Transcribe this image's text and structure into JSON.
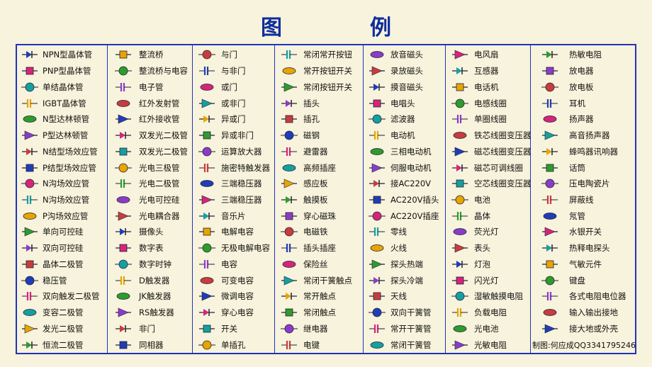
{
  "title": [
    "图",
    "例"
  ],
  "columns": [
    [
      {
        "label": "NPN型晶体管",
        "icon": "npn-transistor-icon"
      },
      {
        "label": "PNP型晶体管",
        "icon": "pnp-transistor-icon"
      },
      {
        "label": "单结晶体管",
        "icon": "unijunction-transistor-icon"
      },
      {
        "label": "IGBT晶体管",
        "icon": "igbt-icon"
      },
      {
        "label": "N型达林顿管",
        "icon": "n-darlington-icon"
      },
      {
        "label": "P型达林顿管",
        "icon": "p-darlington-icon"
      },
      {
        "label": "N结型场效应管",
        "icon": "n-jfet-icon"
      },
      {
        "label": "P结型场效应管",
        "icon": "p-jfet-icon"
      },
      {
        "label": "N沟场效应管",
        "icon": "n-channel-fet-icon"
      },
      {
        "label": "N沟场效应管",
        "icon": "n-channel-fet-icon"
      },
      {
        "label": "P沟场效应管",
        "icon": "p-channel-fet-icon"
      },
      {
        "label": "单向可控硅",
        "icon": "scr-icon"
      },
      {
        "label": "双向可控硅",
        "icon": "triac-icon"
      },
      {
        "label": "晶体二极管",
        "icon": "diode-icon"
      },
      {
        "label": "稳压管",
        "icon": "zener-diode-icon"
      },
      {
        "label": "双向触发二极管",
        "icon": "diac-icon"
      },
      {
        "label": "变容二极管",
        "icon": "varactor-icon"
      },
      {
        "label": "发光二极管",
        "icon": "led-icon"
      },
      {
        "label": "恒流二极管",
        "icon": "constant-current-diode-icon"
      }
    ],
    [
      {
        "label": "整流桥",
        "icon": "bridge-rectifier-icon"
      },
      {
        "label": "整流桥与电容",
        "icon": "rectifier-capacitor-icon"
      },
      {
        "label": "电子管",
        "icon": "vacuum-tube-icon"
      },
      {
        "label": "红外发射管",
        "icon": "ir-emitter-icon"
      },
      {
        "label": "红外接收管",
        "icon": "ir-receiver-icon"
      },
      {
        "label": "双发光二极管",
        "icon": "dual-led-icon"
      },
      {
        "label": "双发光二极管",
        "icon": "dual-led-icon"
      },
      {
        "label": "光电三极管",
        "icon": "phototransistor-icon"
      },
      {
        "label": "光电二极管",
        "icon": "photodiode-icon"
      },
      {
        "label": "光电可控硅",
        "icon": "photo-scr-icon"
      },
      {
        "label": "光电耦合器",
        "icon": "optocoupler-icon"
      },
      {
        "label": "摄像头",
        "icon": "camera-icon"
      },
      {
        "label": "数字表",
        "icon": "digital-meter-icon"
      },
      {
        "label": "数字时钟",
        "icon": "digital-clock-icon"
      },
      {
        "label": "D触发器",
        "icon": "d-flipflop-icon"
      },
      {
        "label": "JK触发器",
        "icon": "jk-flipflop-icon"
      },
      {
        "label": "RS触发器",
        "icon": "rs-flipflop-icon"
      },
      {
        "label": "非门",
        "icon": "not-gate-icon"
      },
      {
        "label": "同相器",
        "icon": "buffer-icon"
      }
    ],
    [
      {
        "label": "与门",
        "icon": "and-gate-icon"
      },
      {
        "label": "与非门",
        "icon": "nand-gate-icon"
      },
      {
        "label": "或门",
        "icon": "or-gate-icon"
      },
      {
        "label": "或非门",
        "icon": "nor-gate-icon"
      },
      {
        "label": "异或门",
        "icon": "xor-gate-icon"
      },
      {
        "label": "异或非门",
        "icon": "xnor-gate-icon"
      },
      {
        "label": "运算放大器",
        "icon": "op-amp-icon"
      },
      {
        "label": "施密特触发器",
        "icon": "schmitt-trigger-icon"
      },
      {
        "label": "三端稳压器",
        "icon": "voltage-regulator-icon"
      },
      {
        "label": "三端稳压器",
        "icon": "voltage-regulator-icon"
      },
      {
        "label": "音乐片",
        "icon": "music-chip-icon"
      },
      {
        "label": "电解电容",
        "icon": "electrolytic-capacitor-icon"
      },
      {
        "label": "无极电解电容",
        "icon": "nonpolar-capacitor-icon"
      },
      {
        "label": "电容",
        "icon": "capacitor-icon"
      },
      {
        "label": "可变电容",
        "icon": "variable-capacitor-icon"
      },
      {
        "label": "微调电容",
        "icon": "trimmer-capacitor-icon"
      },
      {
        "label": "穿心电容",
        "icon": "feedthrough-capacitor-icon"
      },
      {
        "label": "开关",
        "icon": "switch-icon"
      },
      {
        "label": "单插孔",
        "icon": "single-jack-icon"
      }
    ],
    [
      {
        "label": "常闭常开按钮",
        "icon": "nc-no-button-icon"
      },
      {
        "label": "常开按钮开关",
        "icon": "no-button-icon"
      },
      {
        "label": "常闭按钮开关",
        "icon": "nc-button-icon"
      },
      {
        "label": "插头",
        "icon": "plug-icon"
      },
      {
        "label": "插孔",
        "icon": "socket-icon"
      },
      {
        "label": "磁钢",
        "icon": "magnet-icon"
      },
      {
        "label": "避雷器",
        "icon": "lightning-arrester-icon"
      },
      {
        "label": "高频插座",
        "icon": "rf-socket-icon"
      },
      {
        "label": "感应板",
        "icon": "sensor-plate-icon"
      },
      {
        "label": "触摸板",
        "icon": "touch-pad-icon"
      },
      {
        "label": "穿心磁珠",
        "icon": "ferrite-bead-icon"
      },
      {
        "label": "电磁铁",
        "icon": "electromagnet-icon"
      },
      {
        "label": "插头插座",
        "icon": "plug-socket-icon"
      },
      {
        "label": "保险丝",
        "icon": "fuse-icon"
      },
      {
        "label": "常闭干簧触点",
        "icon": "nc-reed-contact-icon"
      },
      {
        "label": "常开触点",
        "icon": "no-contact-icon"
      },
      {
        "label": "常闭触点",
        "icon": "nc-contact-icon"
      },
      {
        "label": "继电器",
        "icon": "relay-icon"
      },
      {
        "label": "电键",
        "icon": "telegraph-key-icon"
      }
    ],
    [
      {
        "label": "放音磁头",
        "icon": "playback-head-icon"
      },
      {
        "label": "录放磁头",
        "icon": "record-head-icon"
      },
      {
        "label": "摸音磁头",
        "icon": "erase-head-icon"
      },
      {
        "label": "电唱头",
        "icon": "phono-cartridge-icon"
      },
      {
        "label": "滤波器",
        "icon": "filter-icon"
      },
      {
        "label": "电动机",
        "icon": "motor-icon"
      },
      {
        "label": "三相电动机",
        "icon": "three-phase-motor-icon"
      },
      {
        "label": "伺服电动机",
        "icon": "servo-motor-icon"
      },
      {
        "label": "接AC220V",
        "icon": "ac220v-terminal-icon"
      },
      {
        "label": "AC220V插头",
        "icon": "ac220v-plug-icon"
      },
      {
        "label": "AC220V插座",
        "icon": "ac220v-socket-icon"
      },
      {
        "label": "零线",
        "icon": "neutral-line-icon"
      },
      {
        "label": "火线",
        "icon": "live-line-icon"
      },
      {
        "label": "探头热端",
        "icon": "probe-hot-icon"
      },
      {
        "label": "探头冷端",
        "icon": "probe-cold-icon"
      },
      {
        "label": "天线",
        "icon": "antenna-icon"
      },
      {
        "label": "双向干簧管",
        "icon": "bidirectional-reed-icon"
      },
      {
        "label": "常开干簧管",
        "icon": "no-reed-icon"
      },
      {
        "label": "常闭干簧管",
        "icon": "nc-reed-icon"
      }
    ],
    [
      {
        "label": "电风扇",
        "icon": "fan-icon"
      },
      {
        "label": "互感器",
        "icon": "transformer-icon"
      },
      {
        "label": "电话机",
        "icon": "telephone-icon"
      },
      {
        "label": "电感线圈",
        "icon": "inductor-icon"
      },
      {
        "label": "单圈线圈",
        "icon": "single-loop-icon"
      },
      {
        "label": "铁芯线圈变压器",
        "icon": "iron-core-transformer-icon"
      },
      {
        "label": "磁芯线圈变压器",
        "icon": "ferrite-core-transformer-icon"
      },
      {
        "label": "磁芯可调线圈",
        "icon": "adjustable-coil-icon"
      },
      {
        "label": "空芯线圈变压器",
        "icon": "air-core-transformer-icon"
      },
      {
        "label": "电池",
        "icon": "battery-icon"
      },
      {
        "label": "晶体",
        "icon": "crystal-icon"
      },
      {
        "label": "荧光灯",
        "icon": "fluorescent-lamp-icon"
      },
      {
        "label": "表头",
        "icon": "meter-icon"
      },
      {
        "label": "灯泡",
        "icon": "bulb-icon"
      },
      {
        "label": "闪光灯",
        "icon": "flash-lamp-icon"
      },
      {
        "label": "湿敏触摸电阻",
        "icon": "humidity-resistor-icon"
      },
      {
        "label": "负载电阻",
        "icon": "load-resistor-icon"
      },
      {
        "label": "光电池",
        "icon": "photocell-icon"
      },
      {
        "label": "光敏电阻",
        "icon": "photoresistor-icon"
      }
    ],
    [
      {
        "label": "热敏电阻",
        "icon": "thermistor-icon"
      },
      {
        "label": "放电器",
        "icon": "discharger-icon"
      },
      {
        "label": "放电板",
        "icon": "discharge-plate-icon"
      },
      {
        "label": "耳机",
        "icon": "earphone-icon"
      },
      {
        "label": "扬声器",
        "icon": "speaker-icon"
      },
      {
        "label": "高音扬声器",
        "icon": "tweeter-icon"
      },
      {
        "label": "蜂鸣器讯响器",
        "icon": "buzzer-icon"
      },
      {
        "label": "话筒",
        "icon": "microphone-icon"
      },
      {
        "label": "压电陶瓷片",
        "icon": "piezo-ceramic-icon"
      },
      {
        "label": "屏蔽线",
        "icon": "shielded-wire-icon"
      },
      {
        "label": "氖管",
        "icon": "neon-tube-icon"
      },
      {
        "label": "水银开关",
        "icon": "mercury-switch-icon"
      },
      {
        "label": "热释电探头",
        "icon": "pyroelectric-sensor-icon"
      },
      {
        "label": "气敏元件",
        "icon": "gas-sensor-icon"
      },
      {
        "label": "键盘",
        "icon": "keypad-icon"
      },
      {
        "label": "各式电阻电位器",
        "icon": "resistor-potentiometer-icon"
      },
      {
        "label": "输入输出接地",
        "icon": "io-ground-icon"
      },
      {
        "label": "接大地或外壳",
        "icon": "earth-ground-icon"
      }
    ]
  ],
  "credit": "制图:何应成QQ3341795246",
  "colors": {
    "background": "#f7f3dc",
    "frame": "#2233bb",
    "title": "#0d2d9c"
  }
}
